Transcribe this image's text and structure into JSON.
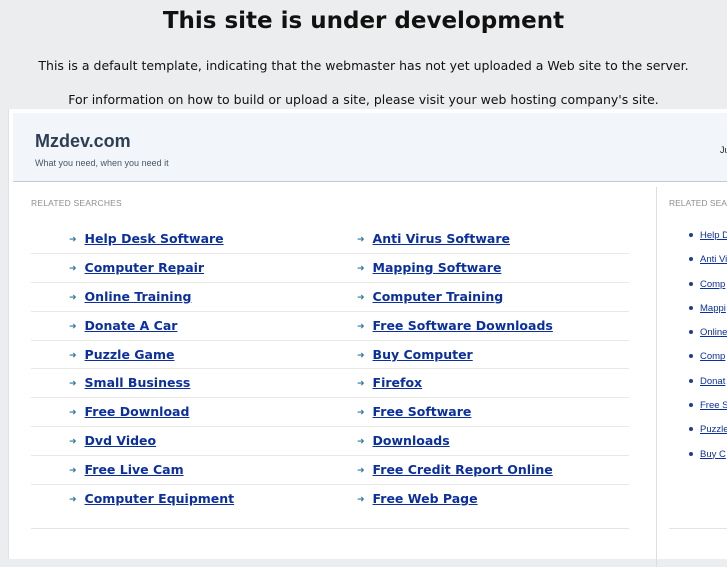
{
  "notice": {
    "title": "This site is under development",
    "line1": "This is a default template, indicating that the webmaster has not yet uploaded a Web site to the server.",
    "line2": "For information on how to build or upload a site, please visit your web hosting company's site."
  },
  "header": {
    "brand": "Mzdev.com",
    "tagline": "What you need, when you need it",
    "date": "Ju"
  },
  "main": {
    "label": "RELATED SEARCHES",
    "rows": [
      [
        "Help Desk Software",
        "Anti Virus Software"
      ],
      [
        "Computer Repair",
        "Mapping Software"
      ],
      [
        "Online Training",
        "Computer Training"
      ],
      [
        "Donate A Car",
        "Free Software Downloads"
      ],
      [
        "Puzzle Game",
        "Buy Computer"
      ],
      [
        "Small Business",
        "Firefox"
      ],
      [
        "Free Download",
        "Free Software"
      ],
      [
        "Dvd Video",
        "Downloads"
      ],
      [
        "Free Live Cam",
        "Free Credit Report Online"
      ],
      [
        "Computer Equipment",
        "Free Web Page"
      ]
    ]
  },
  "sidebar": {
    "label": "RELATED SEA",
    "items": [
      "Help D",
      "Anti Vi",
      "Comp",
      "Mappi",
      "Online",
      "Comp",
      "Donat",
      "Free S",
      "Puzzle",
      "Buy C"
    ]
  },
  "colors": {
    "link": "#0b2f9e",
    "arrow": "#2f7aa8",
    "header_bg": "#f2f6fa",
    "page_bg": "#ecedee"
  }
}
